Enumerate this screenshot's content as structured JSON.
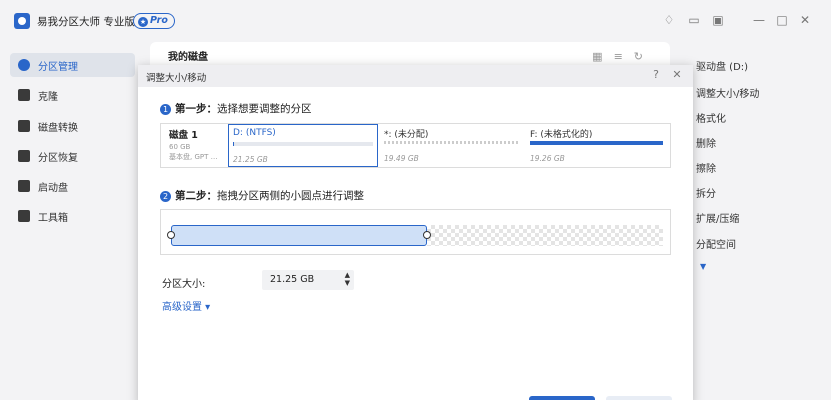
{
  "app": {
    "title": "易我分区大师 专业版",
    "badge": "Pro"
  },
  "sidebar": {
    "items": [
      {
        "label": "分区管理",
        "active": true
      },
      {
        "label": "克隆"
      },
      {
        "label": "磁盘转换"
      },
      {
        "label": "分区恢复"
      },
      {
        "label": "启动盘"
      },
      {
        "label": "工具箱"
      }
    ]
  },
  "main": {
    "title": "我的磁盘"
  },
  "operations": {
    "items": [
      "驱动盘 (D:)",
      "调整大小/移动",
      "格式化",
      "删除",
      "擦除",
      "拆分",
      "扩展/压缩",
      "分配空间"
    ]
  },
  "dialog": {
    "title": "调整大小/移动",
    "step1": {
      "num": "1",
      "title": "第一步：",
      "text": "选择想要调整的分区"
    },
    "disk": {
      "name": "磁盘 1",
      "size": "60 GB",
      "type": "基本盘, GPT …"
    },
    "partitions": [
      {
        "label": "D: (NTFS)",
        "capacity": "21.25 GB",
        "used_fraction": 0.01,
        "selected": true
      },
      {
        "label": "*: (未分配)",
        "capacity": "19.49 GB",
        "used_fraction": 0,
        "unallocated": true
      },
      {
        "label": "F: (未格式化的)",
        "capacity": "19.26 GB",
        "used_fraction": 1.0
      }
    ],
    "step2": {
      "num": "2",
      "title": "第二步：",
      "text": "拖拽分区两侧的小圆点进行调整"
    },
    "size_label": "分区大小:",
    "size_value": "21.25 GB",
    "advanced": "高级设置 ▾"
  },
  "colors": {
    "accent": "#2a66c9",
    "partition_fill": "#cfe0f7"
  }
}
